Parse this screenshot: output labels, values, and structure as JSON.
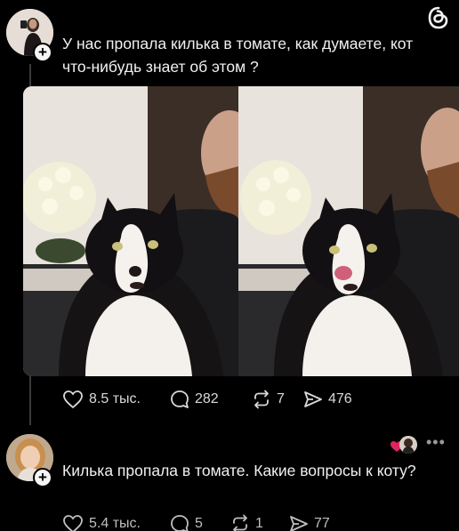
{
  "post1": {
    "text": "У нас пропала килька в томате, как думаете, кот что-нибудь знает об этом ?",
    "likes": "8.5 тыс.",
    "comments": "282",
    "reposts": "7",
    "shares": "476"
  },
  "post2": {
    "text": "Килька пропала в томате. Какие вопросы к коту?",
    "likes": "5.4 тыс.",
    "comments": "5",
    "reposts": "1",
    "shares": "77"
  },
  "icons": {
    "app_logo": "threads-logo-icon",
    "like": "heart-icon",
    "comment": "comment-bubble-icon",
    "repost": "repost-icon",
    "share": "send-icon",
    "follow": "plus-icon",
    "more": "more-dots-icon"
  },
  "colors": {
    "background": "#000000",
    "text": "#f1f1f1",
    "muted": "#d9d9d9",
    "heart_badge": "#e0245e"
  }
}
